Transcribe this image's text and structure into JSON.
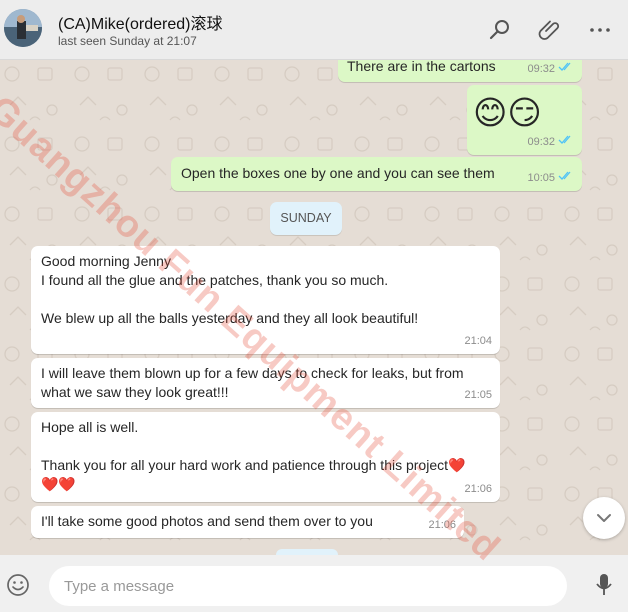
{
  "header": {
    "contact_name": "(CA)Mike(ordered)滚球",
    "last_seen": "last seen Sunday at 21:07",
    "icons": [
      "search-icon",
      "attach-icon",
      "menu-icon"
    ]
  },
  "messages": [
    {
      "direction": "out",
      "text": "There are in the cartons",
      "time": "09:32",
      "status": "read"
    },
    {
      "direction": "out",
      "text": "😊😏",
      "time": "09:32",
      "status": "read"
    },
    {
      "direction": "out",
      "text": "Open the boxes one by one and you can see them",
      "time": "10:05",
      "status": "read"
    },
    {
      "direction": "in",
      "text": "Good morning Jenny\nI found all the glue and the patches, thank you so much.\n\nWe blew up all the balls yesterday and they all look beautiful!",
      "time": "21:04"
    },
    {
      "direction": "in",
      "text": "I will leave them blown up for a few days to check for leaks, but from\nwhat we saw they look great!!!",
      "time": "21:05"
    },
    {
      "direction": "in",
      "text": "Hope all is well.\n\nThank you for all your hard work and patience through this project❤️\n❤️❤️",
      "time": "21:06"
    },
    {
      "direction": "in",
      "text": "I'll take some good photos and send them over to you",
      "time": "21:06"
    }
  ],
  "day_label": "SUNDAY",
  "composer": {
    "placeholder": "Type a message",
    "icons": [
      "emoji-icon",
      "microphone-icon"
    ]
  },
  "watermark": "Guangzhou Fun Equipment Limited",
  "colors": {
    "outgoing_bubble": "#dcf8c6",
    "incoming_bubble": "#ffffff",
    "chat_background": "#e5ddd5",
    "read_ticks": "#4fc3f7",
    "day_label_bg": "#e1f2fb"
  }
}
